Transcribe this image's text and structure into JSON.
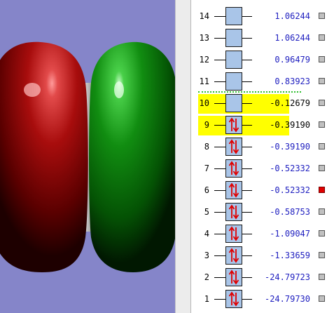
{
  "viewport": {
    "background": "#8585c9",
    "lobe_colors": {
      "left": "#8b0000",
      "right": "#0a7a0a"
    }
  },
  "orbitals": [
    {
      "index": "14",
      "energy": "1.06244",
      "occupied": false,
      "highlighted": false,
      "selected": false
    },
    {
      "index": "13",
      "energy": "1.06244",
      "occupied": false,
      "highlighted": false,
      "selected": false
    },
    {
      "index": "12",
      "energy": "0.96479",
      "occupied": false,
      "highlighted": false,
      "selected": false
    },
    {
      "index": "11",
      "energy": "0.83923",
      "occupied": false,
      "highlighted": false,
      "selected": false
    },
    {
      "index": "10",
      "energy": "-0.12679",
      "occupied": false,
      "highlighted": true,
      "selected": false
    },
    {
      "index": "9",
      "energy": "-0.39190",
      "occupied": true,
      "highlighted": true,
      "selected": false
    },
    {
      "index": "8",
      "energy": "-0.39190",
      "occupied": true,
      "highlighted": false,
      "selected": false
    },
    {
      "index": "7",
      "energy": "-0.52332",
      "occupied": true,
      "highlighted": false,
      "selected": false
    },
    {
      "index": "6",
      "energy": "-0.52332",
      "occupied": true,
      "highlighted": false,
      "selected": true
    },
    {
      "index": "5",
      "energy": "-0.58753",
      "occupied": true,
      "highlighted": false,
      "selected": false
    },
    {
      "index": "4",
      "energy": "-1.09047",
      "occupied": true,
      "highlighted": false,
      "selected": false
    },
    {
      "index": "3",
      "energy": "-1.33659",
      "occupied": true,
      "highlighted": false,
      "selected": false
    },
    {
      "index": "2",
      "energy": "-24.79723",
      "occupied": true,
      "highlighted": false,
      "selected": false
    },
    {
      "index": "1",
      "energy": "-24.79730",
      "occupied": true,
      "highlighted": false,
      "selected": false
    }
  ],
  "colors": {
    "highlight": "#ffff00",
    "level_box": "#a9c5e8",
    "energy_text": "#2020c0",
    "electron_arrow": "#e00000",
    "selected_checkbox": "#e00000",
    "unselected_checkbox": "#c0c0c0",
    "gap_line": "#2fbf2f"
  },
  "icons": {
    "electron_pair": "up-down-arrows-icon",
    "checkbox": "checkbox-icon"
  }
}
